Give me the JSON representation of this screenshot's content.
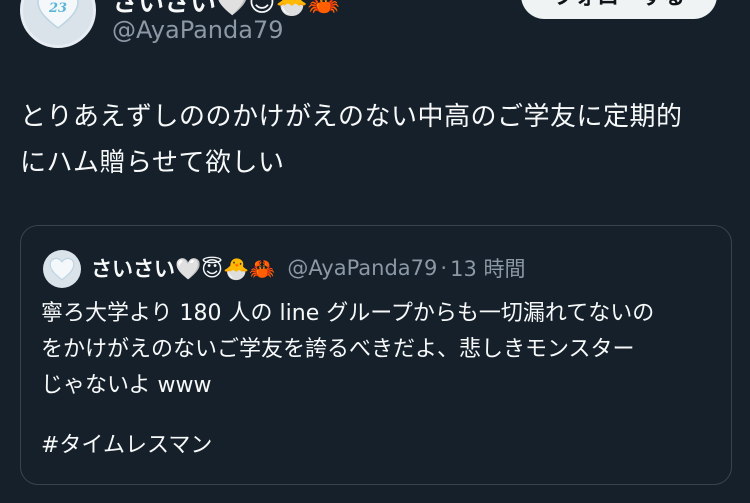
{
  "author": {
    "name": "さいさい🤍😇🐣🦀",
    "handle": "@AyaPanda79",
    "avatar_number": "23"
  },
  "follow_button": {
    "label": "フォローする"
  },
  "tweet": {
    "line1": "とりあえずしののかけがえのない中高のご学友に定期的",
    "line2": "にハム贈らせて欲しい"
  },
  "quote": {
    "name": "さいさい🤍😇🐣🦀",
    "handle": "@AyaPanda79",
    "separator": "·",
    "time": "13 時間",
    "avatar_number": "23",
    "line1": "寧ろ大学より 180 人の line グループからも一切漏れてないの",
    "line2": "をかけがえのないご学友を誇るべきだよ、悲しきモンスター",
    "line3": "じゃないよ www",
    "hashtag": "#タイムレスマン"
  },
  "colors": {
    "background": "#15202b",
    "text": "#f7f9f9",
    "secondary_text": "#8b98a5",
    "border": "#38444d",
    "follow_bg": "#eff3f4"
  }
}
